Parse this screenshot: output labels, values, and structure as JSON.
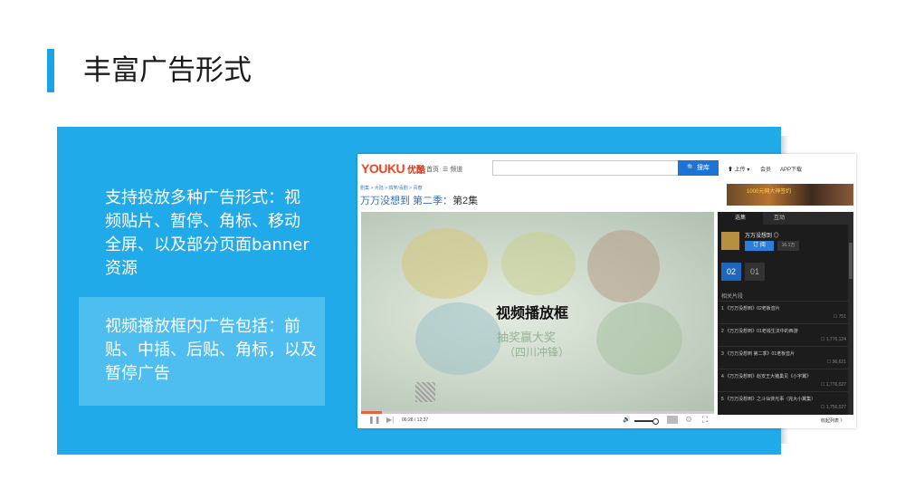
{
  "slide": {
    "title": "丰富广告形式",
    "text_main": "支持投放多种广告形式：视频贴片、暂停、角标、移动全屏、以及部分页面banner资源",
    "text_box": "视频播放框内广告包括：前贴、中插、后贴、角标，以及暂停广告"
  },
  "screenshot": {
    "logo": "YOUKU",
    "logo_cn": "优酷",
    "nav_home": "首页",
    "nav_menu": "☰ 频道",
    "search_placeholder": "",
    "search_button": "🔍 搜库",
    "upload": "⬆ 上传 ▾",
    "member": "会员",
    "app": "APP下载",
    "breadcrumb": "剧集 > 大陆 > 搞笑/喜剧 > 青春",
    "video_title": "万万没想到 第二季：",
    "video_episode": "第2集",
    "banner_text": "1000元网大神签约",
    "player_label": "视频播放框",
    "ad_slogan": "抽奖赢大奖",
    "ad_slogan2": "（四川冲锋）",
    "time": "06:28 / 12:37",
    "progress": 0.06,
    "close_list": "收起列表 〉",
    "sidebar": {
      "tab_selected": "选集",
      "tab_interact": "互动",
      "channel": "万万没想到 ◎",
      "subscribe": "订 阅",
      "sub_count": "16.1万",
      "ep_current": "02",
      "ep_other": "01",
      "related_header": "相关片段",
      "items": [
        {
          "title": "1 《万万没想到》02老板音片",
          "meta": "751"
        },
        {
          "title": "2 《万万没想到》01老钱生法中的西游",
          "meta": "1,776,124"
        },
        {
          "title": "3 《万万没想到 第二季》01老板音片",
          "meta": "96,621"
        },
        {
          "title": "4 《万万没想到》赵安王大猪巢见《小宇翼》",
          "meta": "1,776,027"
        },
        {
          "title": "5 《万万没想到》之斗仙侠光事（完大小翼集）",
          "meta": "1,756,027"
        }
      ]
    }
  }
}
